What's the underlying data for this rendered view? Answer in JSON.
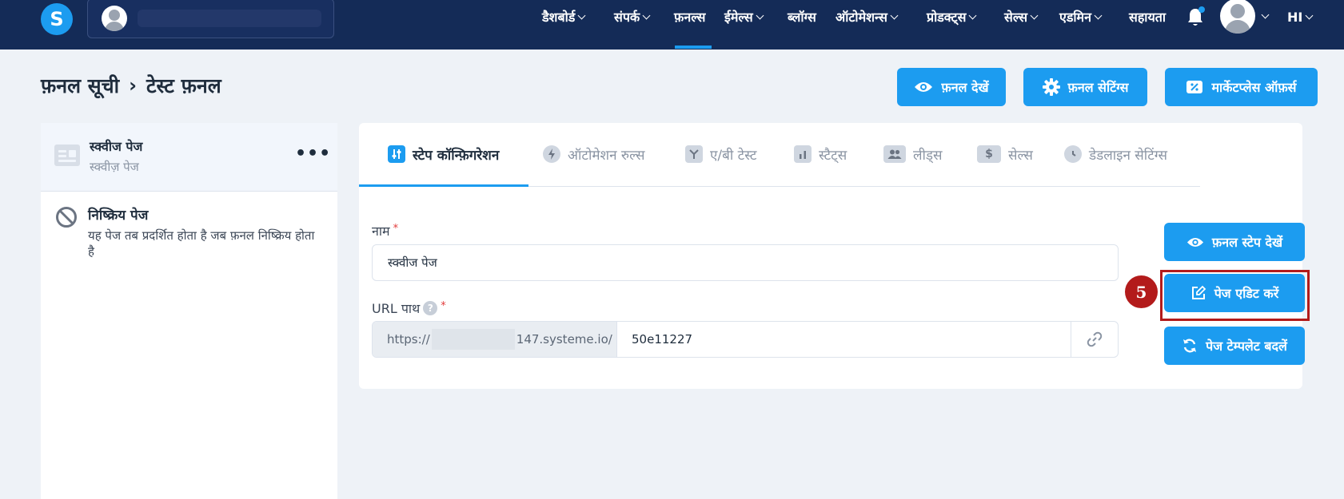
{
  "nav": {
    "items": [
      {
        "label": "डैशबोर्ड",
        "has_dropdown": true
      },
      {
        "label": "संपर्क",
        "has_dropdown": true
      },
      {
        "label": "फ़नल्स",
        "has_dropdown": false,
        "active": true
      },
      {
        "label": "ईमेल्स",
        "has_dropdown": true
      },
      {
        "label": "ब्लॉग्स",
        "has_dropdown": false
      },
      {
        "label": "ऑटोमेशन्स",
        "has_dropdown": true
      },
      {
        "label": "प्रोडक्ट्स",
        "has_dropdown": true
      },
      {
        "label": "सेल्स",
        "has_dropdown": true
      },
      {
        "label": "एडमिन",
        "has_dropdown": true
      },
      {
        "label": "सहायता",
        "has_dropdown": false
      }
    ],
    "language": "HI",
    "logo_letter": "S"
  },
  "header": {
    "breadcrumb_parent": "फ़नल सूची",
    "breadcrumb_separator": "›",
    "breadcrumb_current": "टेस्ट फ़नल",
    "view_funnel_label": "फ़नल देखें",
    "funnel_settings_label": "फ़नल सेटिंग्स",
    "marketplace_label": "मार्केटप्लेस ऑफ़र्स"
  },
  "sidebar": {
    "active_page": {
      "title": "स्क्वीज पेज",
      "subtitle": "स्क्वीज़ पेज",
      "menu": "•••"
    },
    "inactive_page": {
      "title": "निष्क्रिय पेज",
      "description": "यह पेज तब प्रदर्शित होता है जब फ़नल निष्क्रिय होता है"
    }
  },
  "tabs": [
    {
      "label": "स्टेप कॉन्फ़िगरेशन",
      "icon": "sliders-icon",
      "active": true
    },
    {
      "label": "ऑटोमेशन रुल्स",
      "icon": "bolt-icon",
      "active": false
    },
    {
      "label": "ए/बी टेस्ट",
      "icon": "split-icon",
      "active": false
    },
    {
      "label": "स्टैट्स",
      "icon": "bar-chart-icon",
      "active": false
    },
    {
      "label": "लीड्स",
      "icon": "users-icon",
      "active": false
    },
    {
      "label": "सेल्स",
      "icon": "dollar-icon",
      "active": false
    },
    {
      "label": "डेडलाइन सेटिंग्स",
      "icon": "clock-icon",
      "active": false
    }
  ],
  "form": {
    "name_label": "नाम",
    "name_value": "स्क्वीज पेज",
    "required_mark": "*",
    "url_label": "URL पाथ",
    "help_mark": "?",
    "url_prefix_start": "https://",
    "url_prefix_end": "147.systeme.io/",
    "url_slug": "50e11227"
  },
  "actions": {
    "view_step_label": "फ़नल स्टेप देखें",
    "edit_page_label": "पेज एडिट करें",
    "change_template_label": "पेज टेम्पलेट बदलें"
  },
  "annotation": {
    "step_number": "5"
  },
  "colors": {
    "primary": "#1c9cf0",
    "navbar": "#142b57",
    "annotation": "#b31b1b"
  }
}
